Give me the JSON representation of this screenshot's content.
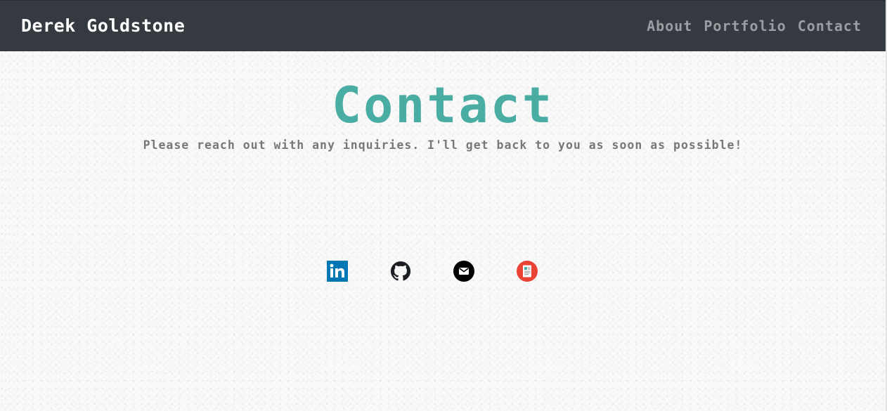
{
  "navbar": {
    "brand": "Derek Goldstone",
    "links": [
      {
        "label": "About"
      },
      {
        "label": "Portfolio"
      },
      {
        "label": "Contact"
      }
    ]
  },
  "main": {
    "title": "Contact",
    "subtitle": "Please reach out with any inquiries. I'll get back to you as soon as possible!"
  },
  "social": [
    {
      "icon": "linkedin-icon",
      "color": "#0077b5"
    },
    {
      "icon": "github-icon",
      "color": "#1b1f23"
    },
    {
      "icon": "email-icon",
      "color": "#000000"
    },
    {
      "icon": "resume-icon",
      "color": "#ea4335"
    }
  ],
  "colors": {
    "navbar_bg": "#343a40",
    "brand": "#ffffff",
    "nav_link": "#9a9da1",
    "title": "#4aada3",
    "subtitle": "#777777"
  }
}
